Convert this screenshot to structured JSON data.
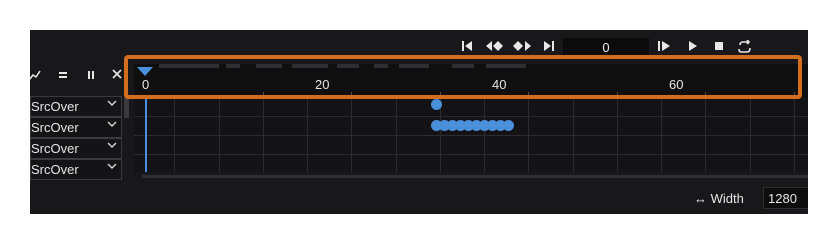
{
  "transport": {
    "frame_value": "0",
    "buttons": [
      "skip-to-start",
      "prev-keyframe",
      "next-keyframe",
      "skip-to-end",
      "step-forward",
      "play",
      "stop",
      "loop"
    ]
  },
  "toolbar": {
    "icons": [
      "curve-icon",
      "equals-icon",
      "pause-icon",
      "close-icon"
    ]
  },
  "ruler": {
    "labels": [
      "0",
      "20",
      "40",
      "60"
    ]
  },
  "layers": [
    {
      "blend": "SrcOver"
    },
    {
      "blend": "SrcOver"
    },
    {
      "blend": "SrcOver"
    },
    {
      "blend": "SrcOver"
    }
  ],
  "footer": {
    "width_label": "↔ Width",
    "width_value": "1280"
  },
  "colors": {
    "accent": "#4a8fdc",
    "highlight": "#d36e1f"
  }
}
